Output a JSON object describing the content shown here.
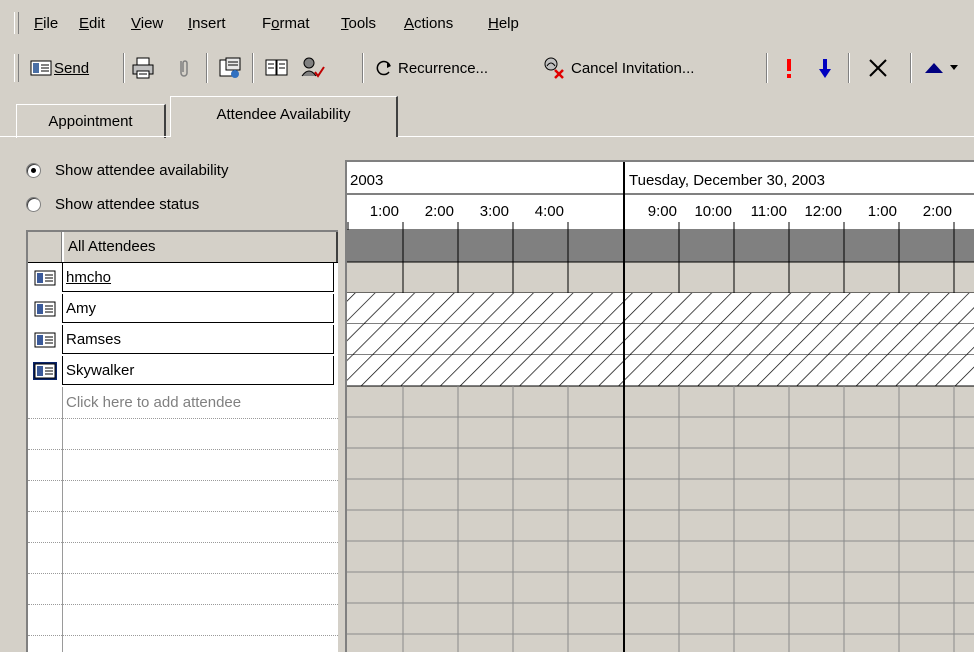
{
  "menu": {
    "items": [
      {
        "label": "File",
        "mnemonic": "F",
        "rest": "ile"
      },
      {
        "label": "Edit",
        "mnemonic": "E",
        "rest": "dit"
      },
      {
        "label": "View",
        "mnemonic": "V",
        "rest": "iew"
      },
      {
        "label": "Insert",
        "mnemonic": "I",
        "rest": "nsert"
      },
      {
        "label": "Format",
        "pre": "F",
        "mnemonic": "o",
        "rest": "rmat"
      },
      {
        "label": "Tools",
        "mnemonic": "T",
        "rest": "ools"
      },
      {
        "label": "Actions",
        "mnemonic": "A",
        "rest": "ctions"
      },
      {
        "label": "Help",
        "mnemonic": "H",
        "rest": "elp"
      }
    ]
  },
  "toolbar": {
    "send_label": "Send",
    "recurrence_label": "Recurrence...",
    "cancel_invitation_label": "Cancel Invitation..."
  },
  "tabs": [
    {
      "label": "Appointment",
      "active": false
    },
    {
      "label": "Attendee Availability",
      "active": true
    }
  ],
  "options": {
    "show_availability": {
      "label": "Show attendee availability",
      "checked": true
    },
    "show_status": {
      "label": "Show attendee status",
      "checked": false
    }
  },
  "attendees": {
    "header": "All Attendees",
    "rows": [
      {
        "name": "hmcho",
        "underlined": true
      },
      {
        "name": "Amy",
        "underlined": false
      },
      {
        "name": "Ramses",
        "underlined": false
      },
      {
        "name": "Skywalker",
        "underlined": false
      }
    ],
    "add_placeholder": "Click here to add attendee"
  },
  "schedule": {
    "day_left": "2003",
    "day_right": "Tuesday, December 30, 2003",
    "times_left": [
      "1:00",
      "2:00",
      "3:00",
      "4:00"
    ],
    "times_right": [
      "9:00",
      "10:00",
      "11:00",
      "12:00",
      "1:00",
      "2:00"
    ]
  },
  "colors": {
    "chrome": "#d4d0c8",
    "header_band": "#808080",
    "priority_high": "#ff0000",
    "priority_low": "#0000c0"
  }
}
